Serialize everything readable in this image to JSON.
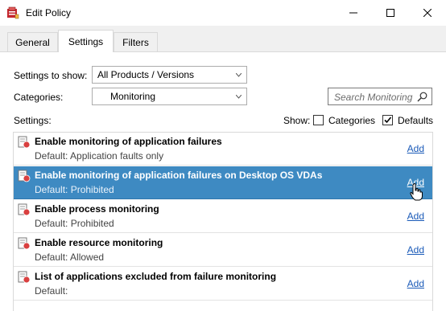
{
  "window": {
    "title": "Edit Policy",
    "icon": "policy-app-icon",
    "controls": [
      "minimize-icon",
      "maximize-icon",
      "close-icon"
    ]
  },
  "tabs": [
    {
      "label": "General",
      "active": false
    },
    {
      "label": "Settings",
      "active": true
    },
    {
      "label": "Filters",
      "active": false
    }
  ],
  "settings_to_show": {
    "label": "Settings to show:",
    "value": "All Products / Versions"
  },
  "categories": {
    "label": "Categories:",
    "value": "Monitoring"
  },
  "search": {
    "placeholder": "Search Monitoring",
    "icon": "search-icon"
  },
  "settings_label": "Settings:",
  "show": {
    "label": "Show:",
    "categories": {
      "label": "Categories",
      "checked": false
    },
    "defaults": {
      "label": "Defaults",
      "checked": true
    }
  },
  "settings": [
    {
      "title": "Enable monitoring of application failures",
      "default": "Default: Application faults only",
      "action": "Add",
      "selected": false
    },
    {
      "title": "Enable monitoring of application failures on Desktop OS VDAs",
      "default": "Default: Prohibited",
      "action": "Add",
      "selected": true
    },
    {
      "title": "Enable process monitoring",
      "default": "Default: Prohibited",
      "action": "Add",
      "selected": false
    },
    {
      "title": "Enable resource monitoring",
      "default": "Default: Allowed",
      "action": "Add",
      "selected": false
    },
    {
      "title": "List of applications excluded from failure monitoring",
      "default": "Default:",
      "action": "Add",
      "selected": false
    }
  ],
  "colors": {
    "selection": "#3e8ac2",
    "link": "#1a5ab8"
  }
}
